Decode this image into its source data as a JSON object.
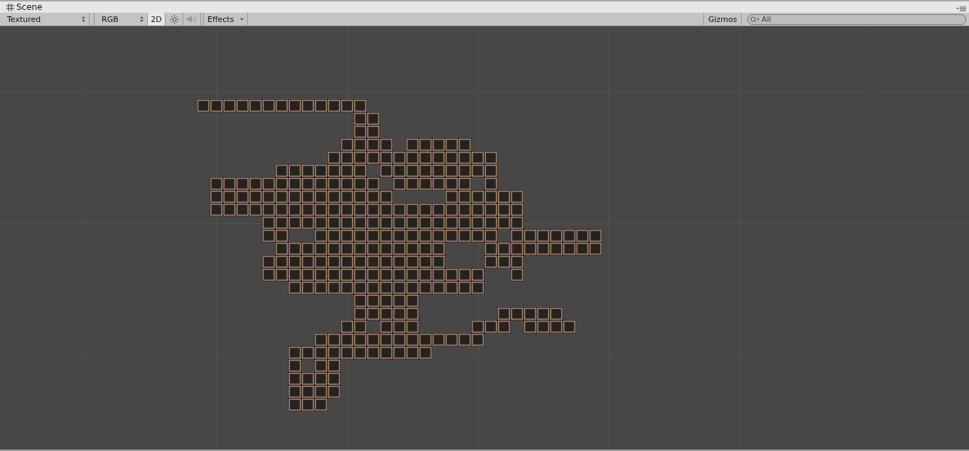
{
  "window": {
    "title": "Scene"
  },
  "toolbar": {
    "draw_mode": "Textured",
    "render_mode": "RGB",
    "toggles": [
      {
        "kind": "text",
        "label": "2D",
        "selected": true
      },
      {
        "kind": "lighting",
        "selected": false
      },
      {
        "kind": "audio",
        "selected": false
      }
    ],
    "effects": "Effects",
    "gizmos": "Gizmos",
    "search": {
      "placeholder": "All"
    }
  }
}
